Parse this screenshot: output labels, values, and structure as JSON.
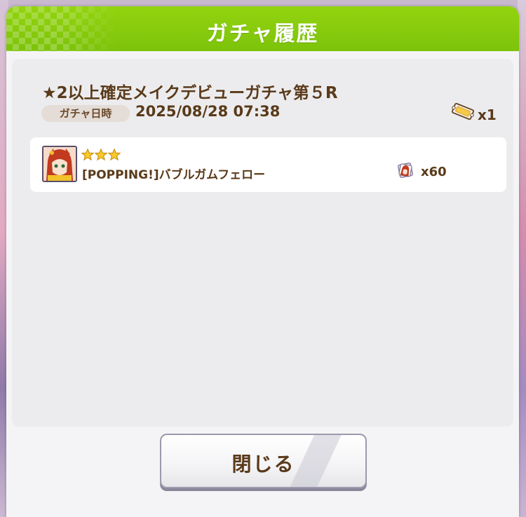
{
  "dialog": {
    "title": "ガチャ履歴",
    "accent_color": "#86cb0c"
  },
  "gacha": {
    "name": "★2以上確定メイクデビューガチャ第５R",
    "date_label": "ガチャ日時",
    "date_value": "2025/08/28 07:38",
    "ticket_icon": "gacha-ticket-icon",
    "ticket_count": "x1"
  },
  "results": [
    {
      "rarity_stars": 3,
      "name": "[POPPING!]バブルガムフェロー",
      "portrait_icon": "character-portrait",
      "piece_icon": "character-piece-icon",
      "piece_count": "x60"
    }
  ],
  "buttons": {
    "close_label": "閉じる"
  }
}
